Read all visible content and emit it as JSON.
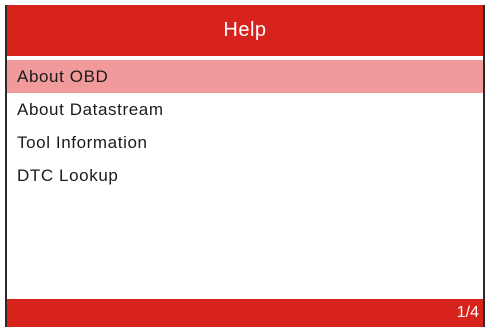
{
  "header": {
    "title": "Help"
  },
  "menu": {
    "items": [
      {
        "label": "About OBD",
        "selected": true
      },
      {
        "label": "About Datastream",
        "selected": false
      },
      {
        "label": "Tool Information",
        "selected": false
      },
      {
        "label": "DTC  Lookup",
        "selected": false
      }
    ]
  },
  "footer": {
    "page_indicator": "1/4"
  },
  "colors": {
    "accent": "#d8231c",
    "selection": "#f09a9b",
    "text": "#1a1a1a"
  }
}
